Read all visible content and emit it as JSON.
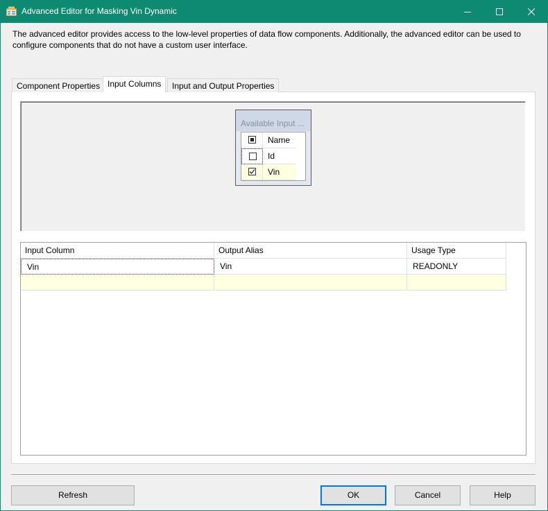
{
  "window": {
    "title": "Advanced Editor for Masking Vin Dynamic",
    "minimize_icon": "minimize-icon",
    "maximize_icon": "maximize-icon",
    "close_icon": "close-icon",
    "accent": "#0e8a72"
  },
  "description": "The advanced editor provides access to the low-level properties of data flow components. Additionally, the advanced editor can be used to configure components that do not have a custom user interface.",
  "tabs": [
    {
      "label": "Component Properties",
      "active": false
    },
    {
      "label": "Input Columns",
      "active": true
    },
    {
      "label": "Input and Output Properties",
      "active": false
    }
  ],
  "available_inputs": {
    "title": "Available Input ...",
    "header_name": "Name",
    "columns": [
      {
        "name": "Id",
        "checked": false
      },
      {
        "name": "Vin",
        "checked": true
      }
    ]
  },
  "mapping_grid": {
    "headers": [
      "Input Column",
      "Output Alias",
      "Usage Type"
    ],
    "rows": [
      {
        "input_column": "Vin",
        "output_alias": "Vin",
        "usage_type": "READONLY"
      }
    ],
    "new_row_color": "#ffffe1"
  },
  "buttons": {
    "refresh": "Refresh",
    "ok": "OK",
    "cancel": "Cancel",
    "help": "Help"
  }
}
